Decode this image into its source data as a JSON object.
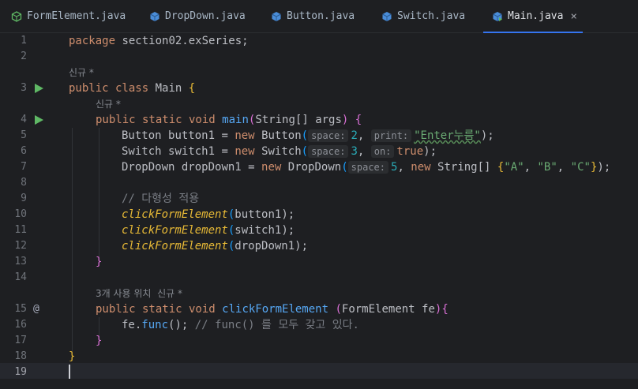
{
  "tabs": [
    {
      "label": "FormElement.java",
      "icon": "interface-icon",
      "active": false
    },
    {
      "label": "DropDown.java",
      "icon": "class-icon",
      "active": false
    },
    {
      "label": "Button.java",
      "icon": "class-icon",
      "active": false
    },
    {
      "label": "Switch.java",
      "icon": "class-icon",
      "active": false
    },
    {
      "label": "Main.java",
      "icon": "class-run-icon",
      "active": true,
      "close": "×"
    }
  ],
  "gutter": {
    "line_numbers": [
      "1",
      "2",
      "3",
      "4",
      "5",
      "6",
      "7",
      "8",
      "9",
      "10",
      "11",
      "12",
      "13",
      "14",
      "15",
      "16",
      "17",
      "18",
      "19"
    ],
    "run_lines": [
      "3",
      "4"
    ],
    "implements_marker": "@",
    "current_line": "19"
  },
  "hints": {
    "main_class": "신규 *",
    "main_method": "신규 *",
    "click_method": "3개 사용 위치  신규 *"
  },
  "code": {
    "l1": {
      "kw": "package",
      "rest": " section02.exSeries;"
    },
    "l3": {
      "kw": "public class",
      "name": "Main",
      "brace": "{"
    },
    "l4": {
      "kw1": "public static void",
      "fn": "main",
      "p1": "(",
      "type": "String[]",
      "arg": "args",
      "p2": ")",
      "brace": "{"
    },
    "l5": {
      "type": "Button",
      "var": "button1",
      "eq": " = ",
      "kw": "new",
      "ctor": "Button",
      "h1": "space:",
      "v1": "2",
      "h2": "print:",
      "v2": "\"Enter누름\"",
      "end": ");"
    },
    "l6": {
      "type": "Switch",
      "var": "switch1",
      "eq": " = ",
      "kw": "new",
      "ctor": "Switch",
      "h1": "space:",
      "v1": "3",
      "h2": "on:",
      "v2": "true",
      "end": ");"
    },
    "l7": {
      "type": "DropDown",
      "var": "dropDown1",
      "eq": " = ",
      "kw": "new",
      "ctor": "DropDown",
      "h1": "space:",
      "v1": "5",
      "kw2": "new",
      "t2": "String[]",
      "a": "\"A\"",
      "b": "\"B\"",
      "c": "\"C\"",
      "end": ");"
    },
    "l9": {
      "comment": "// 다형성 적용"
    },
    "l10": {
      "call": "clickFormElement",
      "arg": "button1",
      "end": ");"
    },
    "l11": {
      "call": "clickFormElement",
      "arg": "switch1",
      "end": ");"
    },
    "l12": {
      "call": "clickFormElement",
      "arg": "dropDown1",
      "end": ");"
    },
    "l13": {
      "brace": "}"
    },
    "l15": {
      "kw": "public static void",
      "fn": "clickFormElement",
      "type": "FormElement",
      "arg": "fe",
      "end": "{"
    },
    "l16": {
      "obj": "fe",
      "fn": "func",
      "end": "();",
      "comment": "// func() 를 모두 갖고 있다."
    },
    "l17": {
      "brace": "}"
    },
    "l18": {
      "brace": "}"
    }
  },
  "colors": {
    "accent": "#3574f0",
    "run": "#5fb865",
    "keyword": "#cf8e6d",
    "function": "#56a8f5",
    "string": "#6aab73",
    "number": "#2aacb8"
  }
}
